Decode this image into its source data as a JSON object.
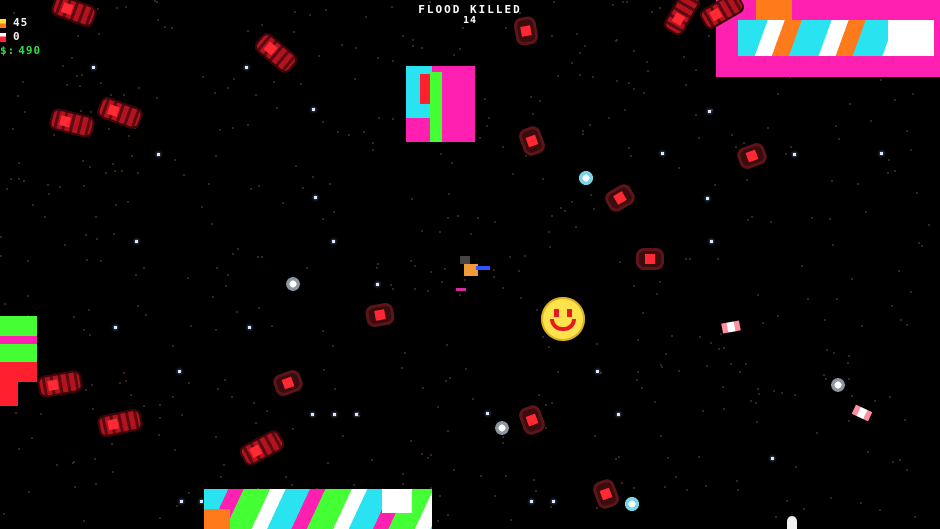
{
  "hud": {
    "health": {
      "icon": "health-icon",
      "value": "45"
    },
    "lives": {
      "icon": "lives-icon",
      "value": "0"
    },
    "money": {
      "icon": "dollar-icon",
      "symbol": "$:",
      "value": "490"
    }
  },
  "kill_counter": {
    "label": "FLOOD KILLED",
    "count": "14"
  },
  "colors": {
    "background": "#000000",
    "hud_text": "#f2f2f2",
    "money_green": "#33dd44",
    "enemy_red": "#ff2a33",
    "magenta": "#ff1fb0",
    "cyan": "#29e3f0",
    "lime": "#44ff33",
    "smiley_yellow": "#ffe34d"
  }
}
